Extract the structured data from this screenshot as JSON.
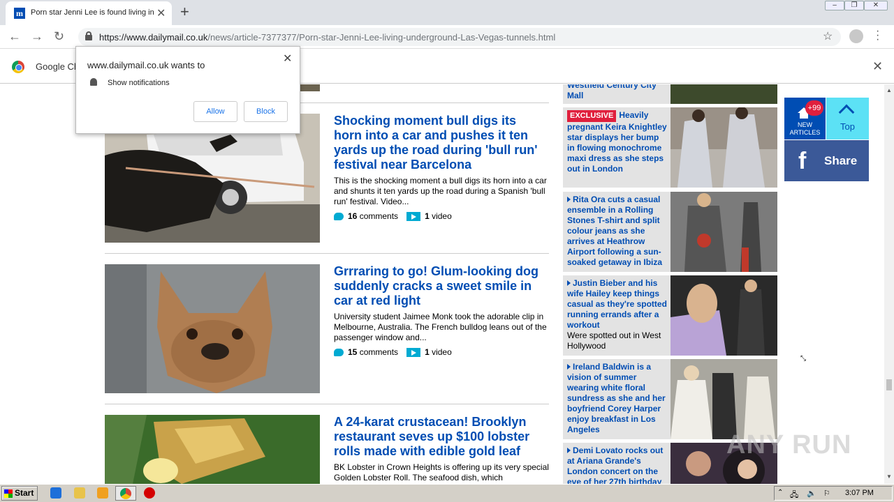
{
  "browser": {
    "tab_title": "Porn star Jenni Lee is found living in",
    "url_host": "https://www.dailymail.co.uk",
    "url_path": "/news/article-7377377/Porn-star-Jenni-Lee-living-underground-Las-Vegas-tunnels.html",
    "infobar_text": "Google Ch"
  },
  "notification": {
    "site": "www.dailymail.co.uk wants to",
    "permission": "Show notifications",
    "allow": "Allow",
    "block": "Block"
  },
  "articles": [
    {
      "headline": "Shocking moment bull digs its horn into a car and pushes it ten yards up the road during 'bull run' festival near Barcelona",
      "summary": "This is the shocking moment a bull digs its horn into a car and shunts it ten yards up the road during a Spanish 'bull run' festival. Video...",
      "comments": "16",
      "comments_label": "comments",
      "videos": "1",
      "video_label": "video"
    },
    {
      "headline": "Grrraring to go! Glum-looking dog suddenly cracks a sweet smile in car at red light",
      "summary": "University student Jaimee Monk took the adorable clip in Melbourne, Australia. The French bulldog leans out of the passenger window and...",
      "comments": "15",
      "comments_label": "comments",
      "videos": "1",
      "video_label": "video"
    },
    {
      "headline": "A 24-karat crustacean! Brooklyn restaurant seves up $100 lobster rolls made with edible gold leaf",
      "summary": "BK Lobster in Crown Heights is offering up its very special Golden Lobster Roll. The seafood dish, which"
    }
  ],
  "sidebar": [
    {
      "text": "Westfield Century City Mall"
    },
    {
      "badge": "EXCLUSIVE",
      "text": "Heavily pregnant Keira Knightley star displays her bump in flowing monochrome maxi dress as she steps out in London"
    },
    {
      "text": "Rita Ora cuts a casual ensemble in a Rolling Stones T-shirt and split colour jeans as she arrives at Heathrow Airport following a sun-soaked getaway in Ibiza"
    },
    {
      "text": "Justin Bieber and his wife Hailey keep things casual as they're spotted running errands after a workout",
      "sub": "Were spotted out in West Hollywood"
    },
    {
      "text": "Ireland Baldwin is a vision of summer wearing white floral sundress as she and her boyfriend Corey Harper enjoy breakfast in Los Angeles"
    },
    {
      "text": "Demi Lovato rocks out at Ariana Grande's London concert on the eve of her 27th birthday"
    }
  ],
  "widgets": {
    "new_count": "+99",
    "new_label_1": "NEW",
    "new_label_2": "ARTICLES",
    "top_label": "Top",
    "share_label": "Share"
  },
  "watermark": "ANY RUN",
  "taskbar": {
    "start": "Start",
    "clock": "3:07 PM"
  }
}
